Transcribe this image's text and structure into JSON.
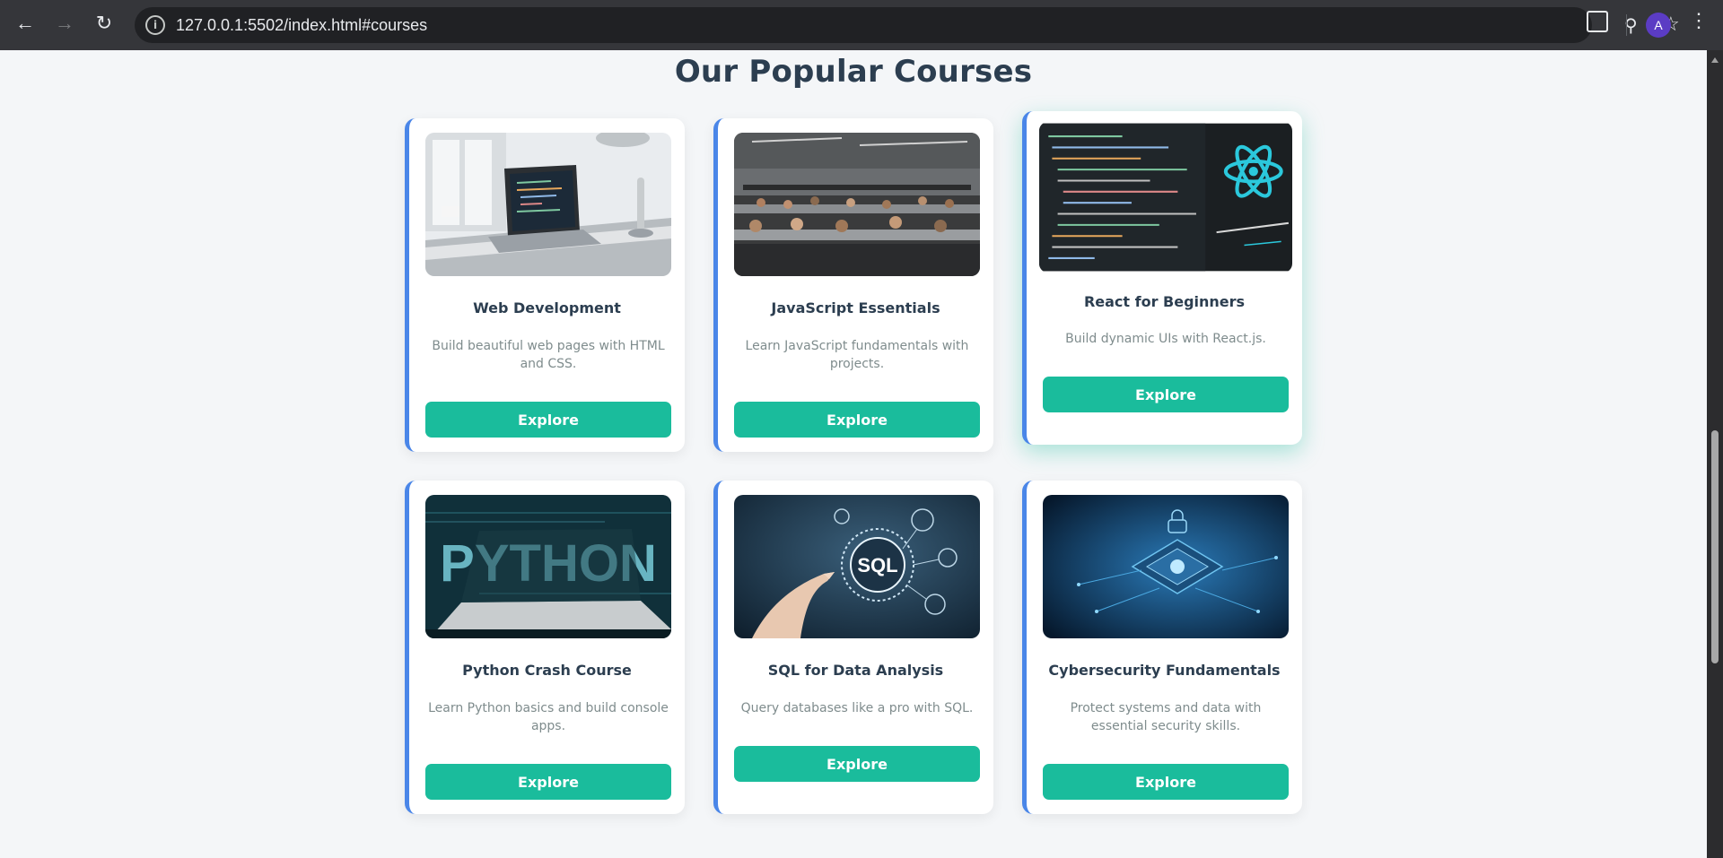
{
  "browser": {
    "url": "127.0.0.1:5502/index.html#courses",
    "profile_initial": "A"
  },
  "section": {
    "title": "Our Popular Courses"
  },
  "courses": [
    {
      "title": "Web Development",
      "description": "Build beautiful web pages with HTML and CSS.",
      "button": "Explore",
      "image": "laptop-desk-image"
    },
    {
      "title": "JavaScript Essentials",
      "description": "Learn JavaScript fundamentals with projects.",
      "button": "Explore",
      "image": "classroom-image"
    },
    {
      "title": "React for Beginners",
      "description": "Build dynamic UIs with React.js.",
      "button": "Explore",
      "image": "react-code-image"
    },
    {
      "title": "Python Crash Course",
      "description": "Learn Python basics and build console apps.",
      "button": "Explore",
      "image": "python-laptop-image"
    },
    {
      "title": "SQL for Data Analysis",
      "description": "Query databases like a pro with SQL.",
      "button": "Explore",
      "image": "sql-touch-image"
    },
    {
      "title": "Cybersecurity Fundamentals",
      "description": "Protect systems and data with essential security skills.",
      "button": "Explore",
      "image": "cyber-circuit-image"
    }
  ],
  "colors": {
    "accent": "#1abc9c",
    "card_border": "#4a86e8",
    "heading": "#2c3e50",
    "muted": "#7f8c8d"
  }
}
